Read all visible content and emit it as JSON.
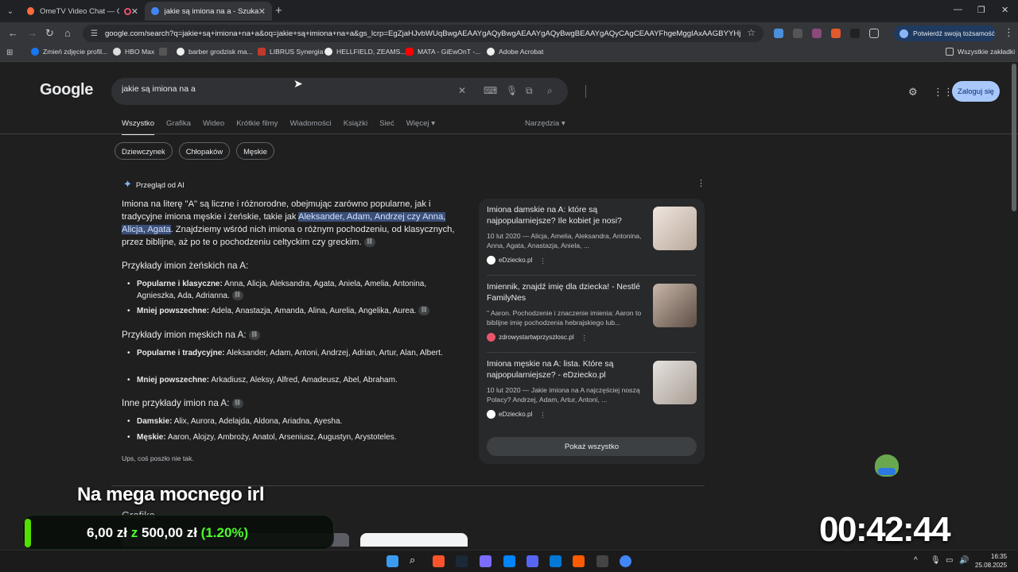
{
  "browser": {
    "tabs": [
      {
        "title": "OmeTV Video Chat — Ome",
        "active": false,
        "recording": true
      },
      {
        "title": "jakie są imiona na a - Szukaj w",
        "active": true
      }
    ],
    "window_controls": [
      "—",
      "❐",
      "✕"
    ],
    "url": "google.com/search?q=jakie+są+imiona+na+a&oq=jakie+są+imiona+na+a&gs_lcrp=EgZjaHJvbWUqBwgAEAAYgAQyBwgAEAAYgAQyBwgBEAAYgAQyCAgCEAAYFhgeMggIAxAAGBYYHjIICAQQA",
    "verify_button": "Potwierdź swoją tożsamość",
    "bookmarks": [
      "Zmień zdjęcie profil...",
      "HBO Max",
      "barber grodzisk ma...",
      "LIBRUS Synergia",
      "HELLFIELD, ZEAMS...",
      "MATA - GiEwOnT -...",
      "Adobe Acrobat"
    ],
    "bookmarks_folder": "Wszystkie zakładki"
  },
  "google": {
    "logo": "Google",
    "query": "jakie są imiona na a",
    "signin": "Zaloguj się",
    "tabs": [
      "Wszystko",
      "Grafika",
      "Wideo",
      "Krótkie filmy",
      "Wiadomości",
      "Książki",
      "Sieć",
      "Więcej ▾"
    ],
    "tools": "Narzędzia ▾",
    "chips": [
      "Dziewczynek",
      "Chłopaków",
      "Męskie"
    ],
    "ai_title": "Przegląd od AI",
    "ai_intro_pre": "Imiona na literę \"A\" są liczne i różnorodne, obejmując zarówno popularne, jak i tradycyjne imiona męskie i żeńskie, takie jak ",
    "ai_intro_hl": "Aleksander, Adam, Andrzej czy Anna, Alicja, Agata",
    "ai_intro_post": ". Znajdziemy wśród nich imiona o różnym pochodzeniu, od klasycznych, przez biblijne, aż po te o pochodzeniu celtyckim czy greckim.",
    "sections": [
      {
        "title": "Przykłady imion żeńskich na A:",
        "items": [
          {
            "label": "Popularne i klasyczne:",
            "text": " Anna, Alicja, Aleksandra, Agata, Aniela, Amelia, Antonina, Agnieszka, Ada, Adrianna."
          },
          {
            "label": "Mniej powszechne:",
            "text": " Adela, Anastazja, Amanda, Alina, Aurelia, Angelika, Aurea."
          }
        ]
      },
      {
        "title": "Przykłady imion męskich na A:",
        "items": [
          {
            "label": "Popularne i tradycyjne:",
            "text": " Aleksander, Adam, Antoni, Andrzej, Adrian, Artur, Alan, Albert."
          },
          {
            "label": "Mniej powszechne:",
            "text": " Arkadiusz, Aleksy, Alfred, Amadeusz, Abel, Abraham."
          }
        ]
      },
      {
        "title": "Inne przykłady imion na A:",
        "items": [
          {
            "label": "Damskie:",
            "text": " Alix, Aurora, Adelajda, Aldona, Ariadna, Ayesha."
          },
          {
            "label": "Męskie:",
            "text": " Aaron, Alojzy, Ambroży, Anatol, Arseniusz, Augustyn, Arystoteles."
          }
        ]
      }
    ],
    "error_note": "Ups, coś poszło nie tak.",
    "sources": [
      {
        "title": "Imiona damskie na A: które są najpopularniejsze? Ile kobiet je nosi?",
        "snippet": "10 lut 2020 — Alicja, Amelia, Aleksandra, Antonina, Anna, Agata, Anastazja, Aniela, ...",
        "site": "eDziecko.pl",
        "site_color": "#ffffff",
        "img_color": "#d9cfc7"
      },
      {
        "title": "Imiennik, znajdź imię dla dziecka! - Nestlé FamilyNes",
        "snippet": "\" Aaron. Pochodzenie i znaczenie imienia: Aaron to biblijne imię pochodzenia hebrajskiego lub...",
        "site": "zdrowystartwprzyszlosc.pl",
        "site_color": "#e8556b",
        "img_color": "#9a8a80"
      },
      {
        "title": "Imiona męskie na A: lista. Które są najpopularniejsze? - eDziecko.pl",
        "snippet": "10 lut 2020 — Jakie imiona na A najczęściej noszą Polacy? Andrzej, Adam, Artur, Antoni, ...",
        "site": "eDziecko.pl",
        "site_color": "#ffffff",
        "img_color": "#c9c2bb"
      }
    ],
    "show_all": "Pokaż wszystko",
    "images_label": "Grafika"
  },
  "overlay": {
    "title": "Na mega mocnego irl",
    "donate_current": "6,00 zł",
    "donate_sep": " z ",
    "donate_goal": "500,00 zł",
    "donate_pct": " (1.20%)",
    "donate_progress": 0.012,
    "timer": "00:42:44"
  },
  "taskbar": {
    "time": "16:35",
    "date": "25.08.2025"
  },
  "colors": {
    "accent_blue": "#8ab4f8",
    "highlight": "#3b4f79",
    "donate_green": "#4cff2a",
    "signin_bg": "#a8c7fa"
  }
}
